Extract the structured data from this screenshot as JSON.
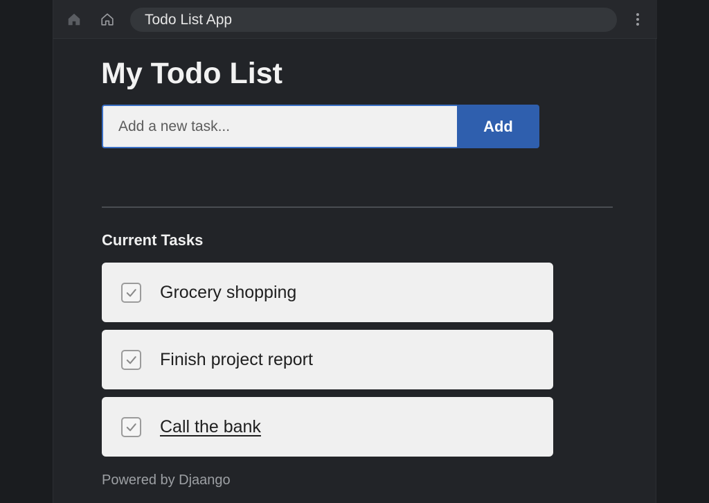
{
  "browser": {
    "address_text": "Todo List App"
  },
  "page": {
    "title": "My Todo List",
    "input_placeholder": "Add a new task...",
    "add_button_label": "Add",
    "section_title": "Current Tasks",
    "tasks": [
      {
        "label": "Grocery shopping",
        "checked": true
      },
      {
        "label": "Finish project report",
        "checked": true
      },
      {
        "label": "Call the bank",
        "checked": true,
        "underlined": true
      }
    ],
    "footer_text": "Powered by Djaango"
  },
  "colors": {
    "page_background": "#222428",
    "accent_blue": "#2f5fae",
    "task_card": "#f0f0f0"
  },
  "icons": {
    "home_filled": "home-icon",
    "home_outline": "home-outline-icon",
    "menu": "more-vertical-icon",
    "check": "check-icon"
  }
}
